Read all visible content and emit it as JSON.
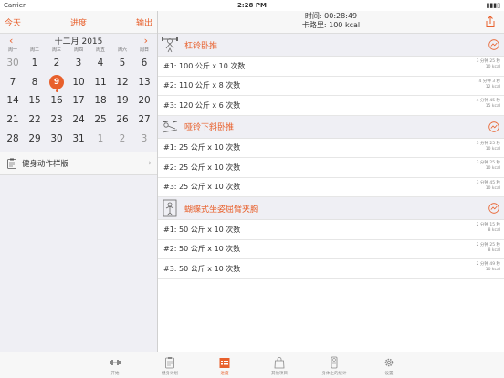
{
  "status": {
    "carrier": "Carrier",
    "time": "2:28 PM",
    "battery": "100%"
  },
  "left_nav": {
    "today": "今天",
    "title": "进度",
    "export": "输出"
  },
  "calendar": {
    "month_label": "十二月 2015",
    "weekdays": [
      "周一",
      "周二",
      "周三",
      "周四",
      "周五",
      "周六",
      "周日"
    ],
    "days": [
      {
        "d": "30",
        "m": true
      },
      {
        "d": "1"
      },
      {
        "d": "2"
      },
      {
        "d": "3"
      },
      {
        "d": "4"
      },
      {
        "d": "5"
      },
      {
        "d": "6"
      },
      {
        "d": "7"
      },
      {
        "d": "8"
      },
      {
        "d": "9",
        "sel": true
      },
      {
        "d": "10"
      },
      {
        "d": "11"
      },
      {
        "d": "12"
      },
      {
        "d": "13"
      },
      {
        "d": "14"
      },
      {
        "d": "15"
      },
      {
        "d": "16"
      },
      {
        "d": "17"
      },
      {
        "d": "18"
      },
      {
        "d": "19"
      },
      {
        "d": "20"
      },
      {
        "d": "21"
      },
      {
        "d": "22"
      },
      {
        "d": "23"
      },
      {
        "d": "24"
      },
      {
        "d": "25"
      },
      {
        "d": "26"
      },
      {
        "d": "27"
      },
      {
        "d": "28"
      },
      {
        "d": "29"
      },
      {
        "d": "30"
      },
      {
        "d": "31"
      },
      {
        "d": "1",
        "m": true
      },
      {
        "d": "2",
        "m": true
      },
      {
        "d": "3",
        "m": true
      }
    ]
  },
  "template_label": "健身动作样版",
  "right_nav": {
    "time_line": "时间: 00:28:49",
    "cal_line": "卡路里: 100 kcal"
  },
  "exercises": [
    {
      "name": "杠铃卧推",
      "sets": [
        {
          "label": "#1: 100 公斤 x 10 次数",
          "dur": "3 分钟 25 秒",
          "kcal": "10 kcal"
        },
        {
          "label": "#2: 110 公斤 x 8 次数",
          "dur": "4 分钟 3 秒",
          "kcal": "12 kcal"
        },
        {
          "label": "#3: 120 公斤 x 6 次数",
          "dur": "4 分钟 45 秒",
          "kcal": "15 kcal"
        }
      ]
    },
    {
      "name": "哑铃下斜卧推",
      "sets": [
        {
          "label": "#1: 25 公斤 x 10 次数",
          "dur": "3 分钟 25 秒",
          "kcal": "10 kcal"
        },
        {
          "label": "#2: 25 公斤 x 10 次数",
          "dur": "3 分钟 25 秒",
          "kcal": "10 kcal"
        },
        {
          "label": "#3: 25 公斤 x 10 次数",
          "dur": "3 分钟 45 秒",
          "kcal": "10 kcal"
        }
      ]
    },
    {
      "name": "蝴蝶式坐姿屈臂夹胸",
      "sets": [
        {
          "label": "#1: 50 公斤 x 10 次数",
          "dur": "2 分钟 15 秒",
          "kcal": "8 kcal"
        },
        {
          "label": "#2: 50 公斤 x 10 次数",
          "dur": "2 分钟 25 秒",
          "kcal": "8 kcal"
        },
        {
          "label": "#3: 50 公斤 x 10 次数",
          "dur": "2 分钟 49 秒",
          "kcal": "10 kcal"
        }
      ]
    }
  ],
  "tabs": [
    {
      "label": "开始",
      "icon": "dumbbell-icon"
    },
    {
      "label": "健身计划",
      "icon": "clipboard-icon"
    },
    {
      "label": "进度",
      "icon": "calendar-icon",
      "active": true
    },
    {
      "label": "其他项目",
      "icon": "bag-icon"
    },
    {
      "label": "身体上的统计",
      "icon": "scale-icon"
    },
    {
      "label": "设置",
      "icon": "gear-icon"
    }
  ],
  "colors": {
    "accent": "#e8602c"
  }
}
